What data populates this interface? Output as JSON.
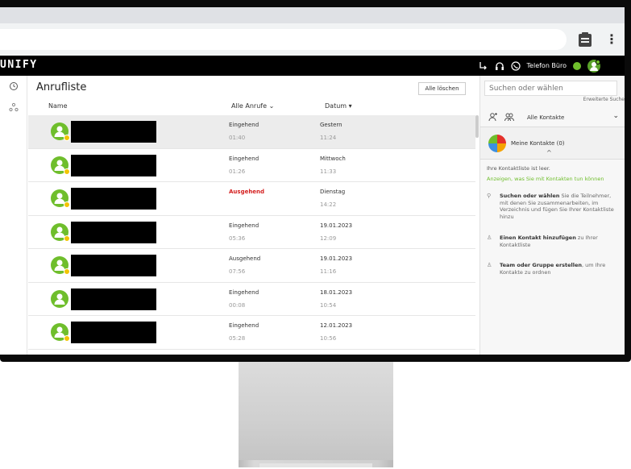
{
  "app": {
    "logo": "UNIFY"
  },
  "topbar": {
    "phone_label": "Telefon Büro"
  },
  "main": {
    "title": "Anrufliste",
    "clear_all_label": "Alle löschen",
    "columns": {
      "name": "Name",
      "filter": "Alle Anrufe",
      "date": "Datum"
    },
    "rows": [
      {
        "direction": "Eingehend",
        "duration": "01:40",
        "day": "Gestern",
        "time": "11:24",
        "outgoing": false,
        "selected": true
      },
      {
        "direction": "Eingehend",
        "duration": "01:26",
        "day": "Mittwoch",
        "time": "11:33",
        "outgoing": false,
        "selected": false
      },
      {
        "direction": "Ausgehend",
        "duration": "",
        "day": "Dienstag",
        "time": "14:22",
        "outgoing": true,
        "selected": false
      },
      {
        "direction": "Eingehend",
        "duration": "05:36",
        "day": "19.01.2023",
        "time": "12:09",
        "outgoing": false,
        "selected": false
      },
      {
        "direction": "Ausgehend",
        "duration": "07:56",
        "day": "19.01.2023",
        "time": "11:16",
        "outgoing": false,
        "selected": false
      },
      {
        "direction": "Eingehend",
        "duration": "00:08",
        "day": "18.01.2023",
        "time": "10:54",
        "outgoing": false,
        "selected": false
      },
      {
        "direction": "Eingehend",
        "duration": "05:28",
        "day": "12.01.2023",
        "time": "10:56",
        "outgoing": false,
        "selected": false
      }
    ]
  },
  "rightpanel": {
    "search_placeholder": "Suchen oder wählen",
    "advanced_search": "Erweiterte Suche",
    "contacts_filter": "Alle Kontakte",
    "my_contacts": "Meine Kontakte (0)",
    "empty_text": "Ihre Kontaktliste ist leer.",
    "empty_link": "Anzeigen, was Sie mit Kontakten tun können",
    "tips": [
      {
        "title": "Suchen oder wählen",
        "text": " Sie die Teilnehmer, mit denen Sie zusammenarbeiten, im Verzeichnis und fügen Sie Ihrer Kontaktliste hinzu"
      },
      {
        "title": "Einen Kontakt hinzufügen",
        "text": " zu Ihrer Kontaktliste"
      },
      {
        "title": "Team oder Gruppe erstellen",
        "text": ", um Ihre Kontakte zu ordnen"
      }
    ]
  },
  "colors": {
    "accent_green": "#6fbe2c",
    "outgoing_red": "#d42020",
    "badge_yellow": "#f2c400"
  }
}
